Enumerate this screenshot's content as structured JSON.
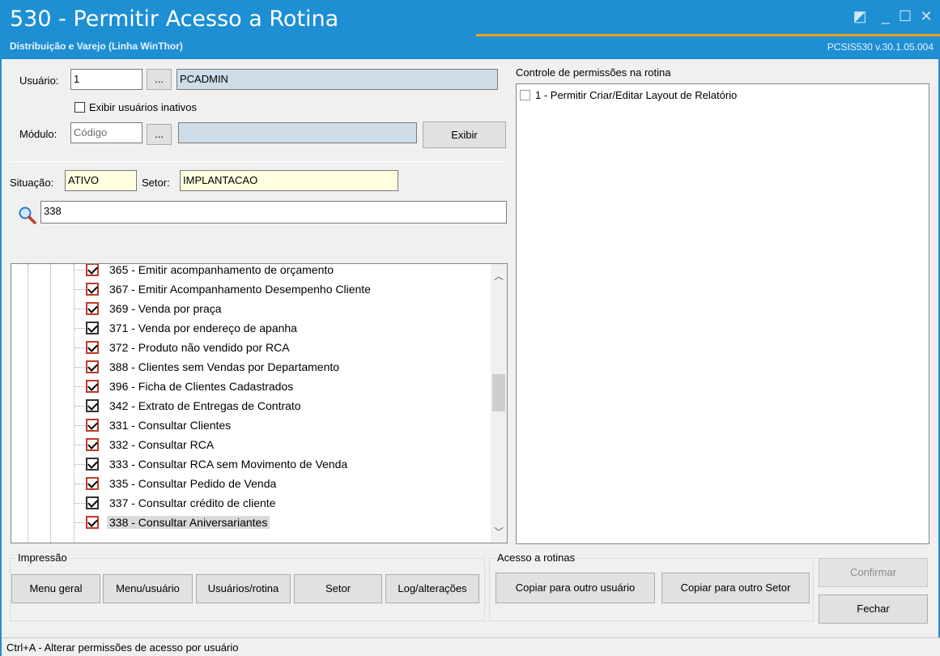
{
  "window": {
    "title": "530 - Permitir Acesso a Rotina",
    "subtitle": "Distribuição e Varejo (Linha WinThor)",
    "version": "PCSIS530  v.30.1.05.004"
  },
  "form": {
    "usuario_label": "Usuário:",
    "usuario_code": "1",
    "usuario_name": "PCADMIN",
    "lookup_label": "...",
    "inativos_label": "Exibir usuários inativos",
    "modulo_label": "Módulo:",
    "modulo_placeholder": "Código",
    "modulo_name": "",
    "exibir_label": "Exibir",
    "situacao_label": "Situação:",
    "situacao_value": "ATIVO",
    "setor_label": "Setor:",
    "setor_value": "IMPLANTACAO",
    "search_value": "338"
  },
  "tree": {
    "items": [
      {
        "label": "365 - Emitir acompanhamento de orçamento",
        "checked": true,
        "red": true
      },
      {
        "label": "367 - Emitir Acompanhamento Desempenho Cliente",
        "checked": true,
        "red": true
      },
      {
        "label": "369 - Venda por praça",
        "checked": true,
        "red": true
      },
      {
        "label": "371 - Venda por endereço de apanha",
        "checked": true,
        "red": false
      },
      {
        "label": "372 - Produto não vendido por RCA",
        "checked": true,
        "red": true
      },
      {
        "label": "388 - Clientes sem Vendas por Departamento",
        "checked": true,
        "red": true
      },
      {
        "label": "396 - Ficha de Clientes Cadastrados",
        "checked": true,
        "red": true
      },
      {
        "label": "342 - Extrato de Entregas de Contrato",
        "checked": true,
        "red": false
      },
      {
        "label": "331 - Consultar Clientes",
        "checked": true,
        "red": true
      },
      {
        "label": "332 - Consultar RCA",
        "checked": true,
        "red": true
      },
      {
        "label": "333 - Consultar RCA sem Movimento de Venda",
        "checked": true,
        "red": false
      },
      {
        "label": "335 - Consultar Pedido de Venda",
        "checked": true,
        "red": true
      },
      {
        "label": "337 - Consultar crédito de cliente",
        "checked": true,
        "red": false
      },
      {
        "label": "338 - Consultar Aniversariantes",
        "checked": true,
        "red": true,
        "selected": true
      }
    ]
  },
  "permissions": {
    "title": "Controle de permissões na rotina",
    "items": [
      {
        "label": "1 - Permitir Criar/Editar Layout de Relatório",
        "checked": false
      }
    ]
  },
  "impressao": {
    "title": "Impressão",
    "buttons": [
      "Menu geral",
      "Menu/usuário",
      "Usuários/rotina",
      "Setor",
      "Log/alterações"
    ]
  },
  "acesso": {
    "title": "Acesso a rotinas",
    "buttons": [
      "Copiar para outro usuário",
      "Copiar para outro Setor"
    ]
  },
  "actions": {
    "confirmar": "Confirmar",
    "fechar": "Fechar"
  },
  "status": "Ctrl+A - Alterar permissões de acesso por usuário"
}
